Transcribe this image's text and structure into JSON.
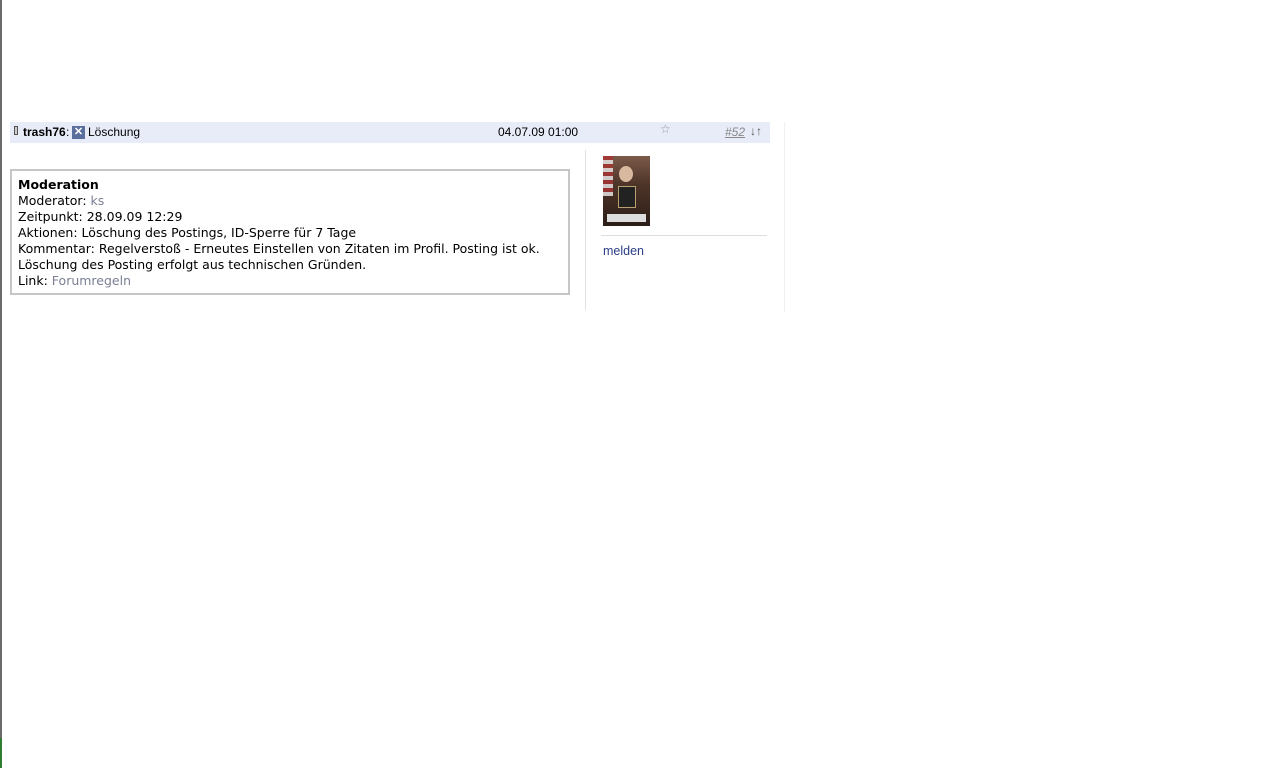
{
  "post": {
    "author": "trash76",
    "colon": ":",
    "status_label": "Löschung",
    "timestamp": "04.07.09 01:00",
    "post_number": "#52",
    "nav_arrows": "↓↑",
    "star_glyph": "☆"
  },
  "moderation": {
    "title": "Moderation",
    "moderator_label": "Moderator: ",
    "moderator_name": "ks",
    "time_label": "Zeitpunkt: ",
    "time_value": "28.09.09 12:29",
    "actions_label": "Aktionen: ",
    "actions_value": "Löschung des Postings, ID-Sperre für 7 Tage",
    "comment_label": "Kommentar: ",
    "comment_value": "Regelverstoß - Erneutes Einstellen von Zitaten im Profil. Posting ist ok.",
    "comment_value_2": "Löschung des Posting erfolgt aus technischen Gründen.",
    "link_label": "Link: ",
    "link_text": "Forumregeln"
  },
  "sidebar": {
    "report_label": "melden"
  },
  "icons": {
    "delete": "✕"
  },
  "colors": {
    "header_bg": "#e8ecf8",
    "link_blue": "#2b3e86",
    "link_gray": "#7a7f93"
  }
}
